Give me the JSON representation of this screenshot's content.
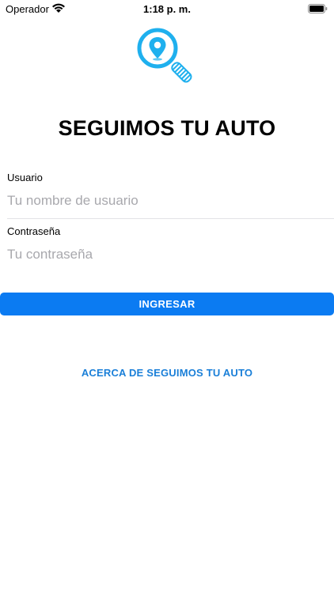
{
  "status_bar": {
    "carrier": "Operador",
    "time": "1:18 p. m.",
    "wifi_icon": "wifi-icon",
    "battery_icon": "battery-icon"
  },
  "logo": {
    "icon": "magnifier-location-pin-icon",
    "colors": {
      "ring": "#1fb0ee",
      "handle_stripes": "#1fb0ee"
    }
  },
  "title": "SEGUIMOS TU AUTO",
  "form": {
    "username": {
      "label": "Usuario",
      "placeholder": "Tu nombre de usuario",
      "value": ""
    },
    "password": {
      "label": "Contraseña",
      "placeholder": "Tu contraseña",
      "value": ""
    },
    "submit_label": "INGRESAR"
  },
  "about_link": "ACERCA DE SEGUIMOS TU AUTO",
  "colors": {
    "button": "#0b7bf2",
    "link": "#1a7fd8",
    "placeholder": "#a8a8ad"
  }
}
